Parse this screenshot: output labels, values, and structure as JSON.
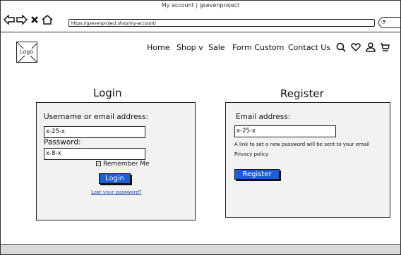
{
  "window": {
    "title": "My account | gsevenproject"
  },
  "browser": {
    "url": "https://gsevenproject.shop/my-account/",
    "back_icon": "back-arrow-icon",
    "forward_icon": "forward-arrow-icon",
    "stop_icon": "close-icon",
    "home_icon": "home-icon"
  },
  "header": {
    "logo_label": "Logo",
    "menu": {
      "home": "Home",
      "shop": "Shop v",
      "sale": "Sale",
      "form_custom": "Form Custom",
      "contact": "Contact Us"
    },
    "icons": [
      "search-icon",
      "heart-icon",
      "user-icon",
      "cart-icon"
    ]
  },
  "login": {
    "title": "Login",
    "username_label": "Username or email address:",
    "username_value": "x-25-x",
    "password_label": "Password:",
    "password_value": "x-8-x",
    "remember_label": "Remember Me",
    "remember_checked": true,
    "button": "Login",
    "lost_password": "Lost your password?"
  },
  "register": {
    "title": "Register",
    "email_label": "Email address:",
    "email_value": "x-25-x",
    "note": "A link to set a new password will be sent to your email",
    "privacy": "Privacy policy",
    "button": "Register"
  },
  "colors": {
    "accent": "#1a5fd6",
    "panel": "#f2f2f2",
    "link": "#1a3fb0"
  }
}
